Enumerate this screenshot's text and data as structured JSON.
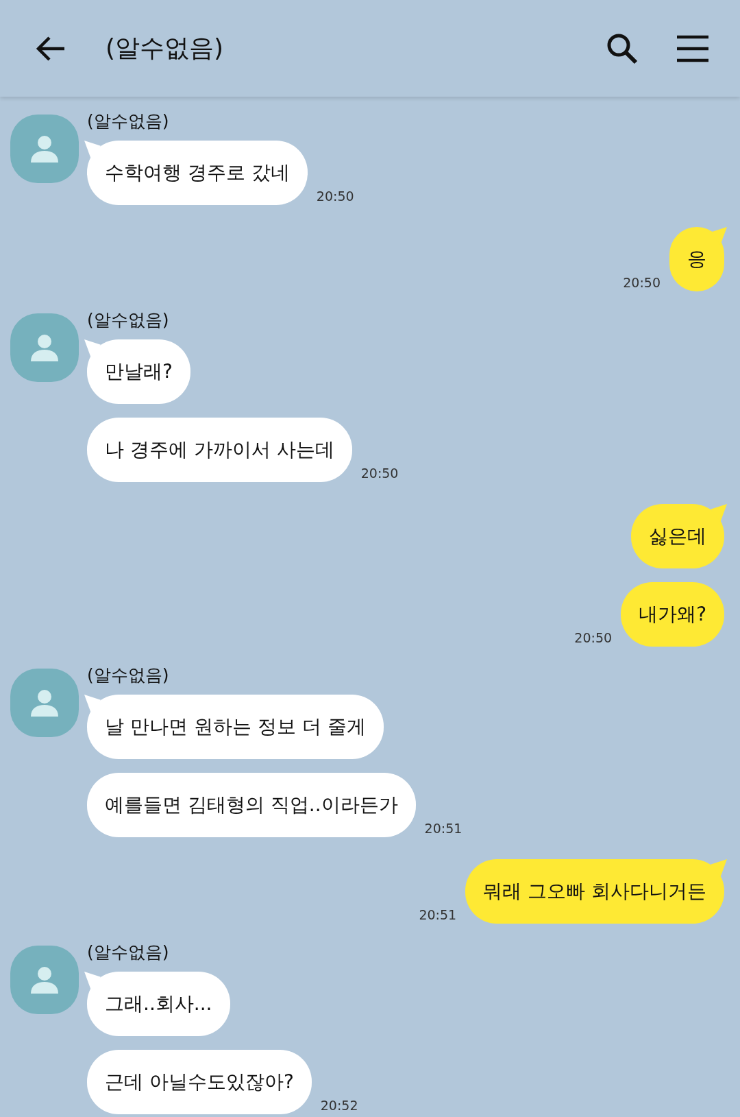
{
  "header": {
    "title": "(알수없음)"
  },
  "messages": [
    {
      "kind": "received",
      "sender": "(알수없음)",
      "bubbles": [
        "수학여행 경주로 갔네"
      ],
      "time": "20:50"
    },
    {
      "kind": "sent",
      "bubbles": [
        "응"
      ],
      "time": "20:50"
    },
    {
      "kind": "received",
      "sender": "(알수없음)",
      "bubbles": [
        "만날래?",
        "나 경주에 가까이서 사는데"
      ],
      "time": "20:50"
    },
    {
      "kind": "sent",
      "bubbles": [
        "싫은데",
        "내가왜?"
      ],
      "time": "20:50"
    },
    {
      "kind": "received",
      "sender": "(알수없음)",
      "bubbles": [
        "날 만나면 원하는 정보 더 줄게",
        "예를들면 김태형의 직업..이라든가"
      ],
      "time": "20:51"
    },
    {
      "kind": "sent",
      "bubbles": [
        "뭐래 그오빠 회사다니거든"
      ],
      "time": "20:51"
    },
    {
      "kind": "received",
      "sender": "(알수없음)",
      "bubbles": [
        "그래..회사...",
        "근데 아닐수도있잖아?"
      ],
      "time": "20:52"
    }
  ]
}
